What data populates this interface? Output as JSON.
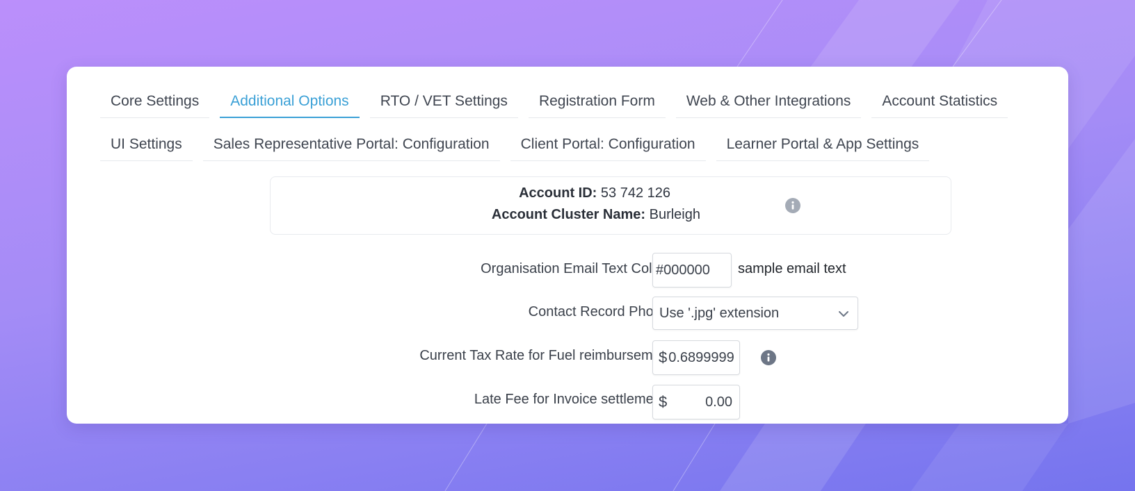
{
  "tabs_row1": [
    {
      "label": "Core Settings",
      "active": false
    },
    {
      "label": "Additional Options",
      "active": true
    },
    {
      "label": "RTO / VET Settings",
      "active": false
    },
    {
      "label": "Registration Form",
      "active": false
    },
    {
      "label": "Web & Other Integrations",
      "active": false
    },
    {
      "label": "Account Statistics",
      "active": false
    }
  ],
  "tabs_row2": [
    {
      "label": "UI Settings",
      "active": false
    },
    {
      "label": "Sales Representative Portal: Configuration",
      "active": false
    },
    {
      "label": "Client Portal: Configuration",
      "active": false
    },
    {
      "label": "Learner Portal & App Settings",
      "active": false
    }
  ],
  "account": {
    "id_label": "Account ID:",
    "id_value": "53 742 126",
    "cluster_label": "Account Cluster Name:",
    "cluster_value": "Burleigh",
    "info_icon": "info-icon"
  },
  "form": {
    "email_colour": {
      "label": "Organisation Email Text Colour:",
      "value": "#000000",
      "sample": "sample email text"
    },
    "photos": {
      "label": "Contact Record Photos:",
      "value": "Use '.jpg' extension",
      "icon": "chevron-down-icon"
    },
    "tax_rate": {
      "label": "Current Tax Rate for Fuel reimbursement:",
      "currency": "$",
      "value": "0.6899999",
      "icon": "info-icon"
    },
    "late_fee": {
      "label": "Late Fee for Invoice settlements:",
      "currency": "$",
      "value": "0.00"
    }
  },
  "colors": {
    "accent": "#3aa0d6",
    "background_top": "#bb8ffb",
    "background_bottom": "#7574ee"
  }
}
